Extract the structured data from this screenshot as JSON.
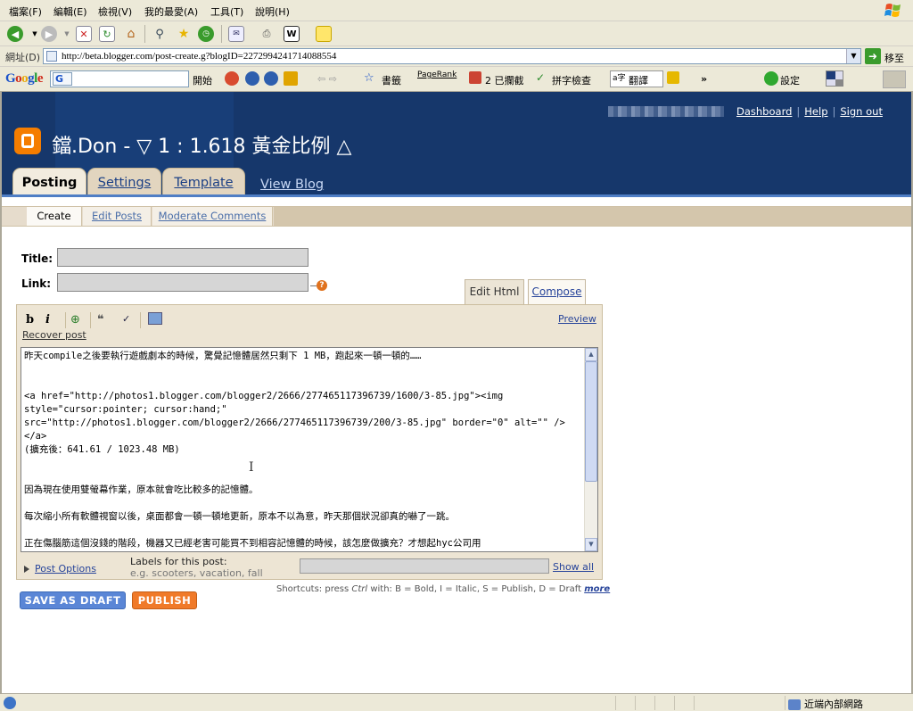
{
  "menu": [
    "檔案(F)",
    "編輯(E)",
    "檢視(V)",
    "我的最愛(A)",
    "工具(T)",
    "說明(H)"
  ],
  "address": {
    "label": "網址(D)",
    "url": "http://beta.blogger.com/post-create.g?blogID=2272994241714088554",
    "go_label": "移至"
  },
  "google_toolbar": {
    "logo": "Google",
    "search_engine_letter": "G",
    "search_button": "開始",
    "bookmarks": "書籤",
    "pagerank": "PageRank",
    "blocked": "2 已攔截",
    "spellcheck": "拼字檢查",
    "translate": "翻譯",
    "settings": "設定"
  },
  "blogger": {
    "toplinks": [
      "Dashboard",
      "Help",
      "Sign out"
    ],
    "blog_title": "鐺.Don - ▽ 1 : 1.618 黃金比例 △",
    "tabs": [
      "Posting",
      "Settings",
      "Template"
    ],
    "view_blog": "View Blog",
    "subtabs": [
      "Create",
      "Edit Posts",
      "Moderate Comments"
    ],
    "title_label": "Title:",
    "link_label": "Link:",
    "help_label": "?",
    "mode_tabs": [
      "Edit Html",
      "Compose"
    ],
    "toolbar": {
      "bold": "b",
      "italic": "i"
    },
    "preview": "Preview",
    "recover": "Recover post",
    "body": "昨天compile之後要執行遊戲劇本的時候，驚覺記憶體居然只剩下 1 MB，跑起來一頓一頓的……\n\n\n<a href=\"http://photos1.blogger.com/blogger2/2666/277465117396739/1600/3-85.jpg\"><img style=\"cursor:pointer; cursor:hand;\" src=\"http://photos1.blogger.com/blogger2/2666/277465117396739/200/3-85.jpg\" border=\"0\" alt=\"\" /></a>\n(擴充後：641.61 / 1023.48 MB)\n\n\n因為現在使用雙螢幕作業，原本就會吃比較多的記憶體。\n\n每次縮小所有軟體視窗以後，桌面都會一頓一頓地更新，原本不以為意，昨天那個狀況卻真的嚇了一跳。\n\n正在傷腦筋這個沒錢的階段，機器又已經老害可能買不到相容記憶體的時候，該怎麼做擴充？才想起hyc公司用",
    "post_options": "Post Options",
    "labels_title": "Labels for this post:",
    "labels_example": "e.g. scooters, vacation, fall",
    "show_all": "Show all",
    "shortcuts_prefix": "Shortcuts: press",
    "shortcuts_ctrl": "Ctrl",
    "shortcuts_mid": "with:",
    "shortcuts_keys": "B = Bold, I = Italic, S = Publish, D = Draft",
    "shortcuts_more": "more",
    "save_draft": "SAVE AS DRAFT",
    "publish": "PUBLISH"
  },
  "status": {
    "zone": "近端內部網路"
  },
  "colors": {
    "header_bg": "#16376b",
    "blogger_orange": "#f57d00",
    "draft_btn": "#5a86d6",
    "publish_btn": "#f07a29"
  }
}
